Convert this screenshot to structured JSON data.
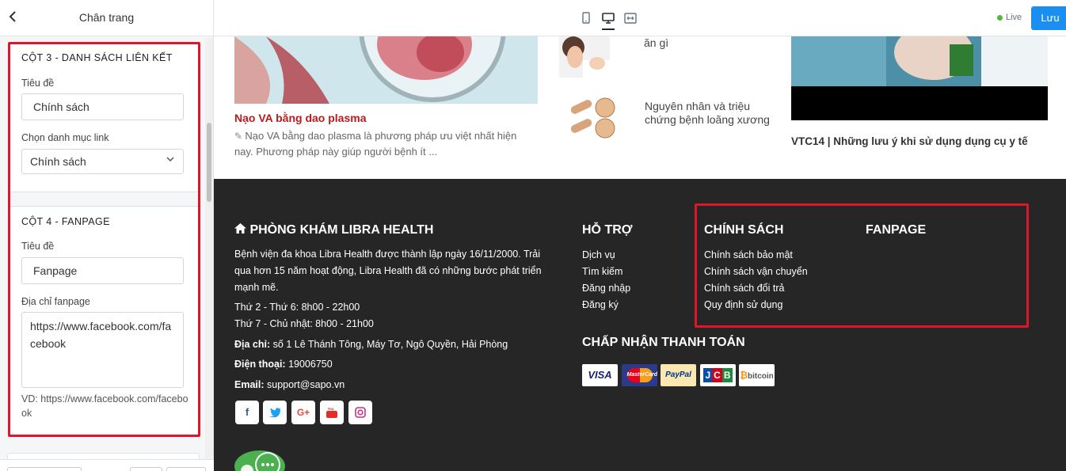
{
  "sidebar": {
    "title": "Chân trang",
    "col3": {
      "heading": "CỘT 3 - DANH SÁCH LIÊN KẾT",
      "title_label": "Tiêu đề",
      "title_value": "Chính sách",
      "link_label": "Chọn danh mục link",
      "link_value": "Chính sách"
    },
    "col4": {
      "heading": "CỘT 4 - FANPAGE",
      "title_label": "Tiêu đề",
      "title_value": "Fanpage",
      "url_label": "Địa chỉ fanpage",
      "url_value": "https://www.facebook.com/facebook",
      "hint": "VD: https://www.facebook.com/facebook"
    }
  },
  "topbar": {
    "live_label": "Live",
    "save_label": "Lưu"
  },
  "preview": {
    "article": {
      "title": "Nạo VA bằng dao plasma",
      "excerpt": "Nạo VA bằng dao plasma là phương pháp ưu việt nhất hiện nay. Phương pháp này giúp người bệnh ít ..."
    },
    "side_items": [
      {
        "title": "ăn gì"
      },
      {
        "title": "Nguyên nhân và triệu chứng bệnh loãng xương"
      }
    ],
    "video_caption": "VTC14 | Những lưu ý khi sử dụng dụng cụ y tế"
  },
  "footer": {
    "about": {
      "heading": "PHÒNG KHÁM LIBRA HEALTH",
      "desc": "Bệnh viện đa khoa Libra Health được thành lập ngày 16/11/2000. Trải qua hơn 15 năm hoạt động, Libra Health đã có những bước phát triển mạnh mẽ.",
      "hours1": "Thứ 2 - Thứ 6: 8h00 - 22h00",
      "hours2": "Thứ 7 - Chủ nhật: 8h00 - 21h00",
      "address_label": "Địa chỉ:",
      "address": "số 1 Lê Thánh Tông, Máy Tơ, Ngô Quyền, Hải Phòng",
      "phone_label": "Điện thoại:",
      "phone": "19006750",
      "email_label": "Email:",
      "email": "support@sapo.vn"
    },
    "support": {
      "heading": "HỖ TRỢ",
      "links": [
        "Dịch vụ",
        "Tìm kiếm",
        "Đăng nhập",
        "Đăng ký"
      ]
    },
    "policy": {
      "heading": "CHÍNH SÁCH",
      "links": [
        "Chính sách bảo mật",
        "Chính sách vận chuyển",
        "Chính sách đổi trả",
        "Quy định sử dụng"
      ]
    },
    "fanpage": {
      "heading": "FANPAGE"
    },
    "payment": {
      "heading": "CHẤP NHẬN THANH TOÁN",
      "methods": [
        "VISA",
        "MasterCard",
        "PayPal",
        "JCB",
        "bitcoin"
      ]
    },
    "social_icons": [
      "facebook-icon",
      "twitter-icon",
      "google-plus-icon",
      "youtube-icon",
      "instagram-icon"
    ]
  },
  "colors": {
    "accent": "#1a8ef1",
    "highlight": "#e0142a",
    "footer_bg": "#262626",
    "article_title": "#b71c1c"
  }
}
